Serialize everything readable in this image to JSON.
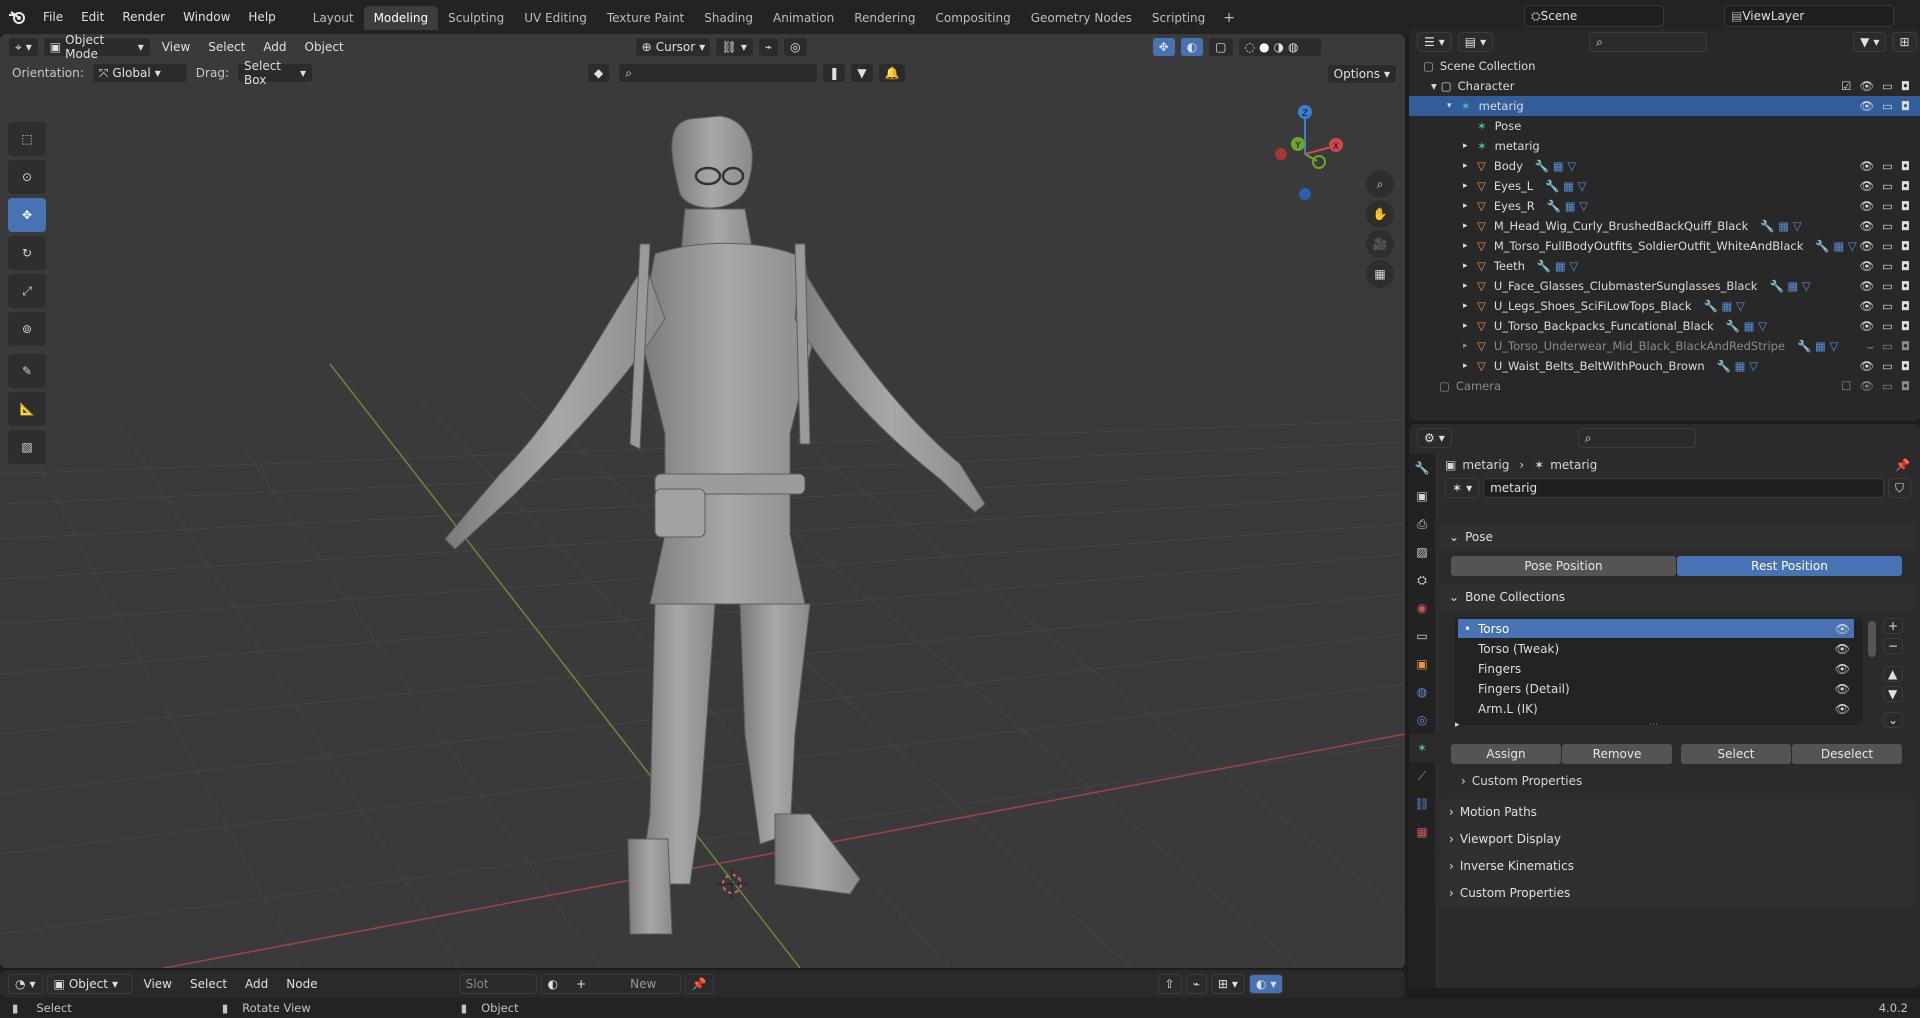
{
  "menu": [
    "File",
    "Edit",
    "Render",
    "Window",
    "Help"
  ],
  "workspaces": [
    "Layout",
    "Modeling",
    "Sculpting",
    "UV Editing",
    "Texture Paint",
    "Shading",
    "Animation",
    "Rendering",
    "Compositing",
    "Geometry Nodes",
    "Scripting"
  ],
  "active_workspace": "Modeling",
  "scene": "Scene",
  "view_layer": "ViewLayer",
  "viewport": {
    "mode": "Object Mode",
    "menus": [
      "View",
      "Select",
      "Add",
      "Object"
    ],
    "orientation_label": "Orientation:",
    "orientation": "Global",
    "drag_label": "Drag:",
    "drag": "Select Box",
    "pivot": "Cursor",
    "options": "Options"
  },
  "outliner": {
    "root": "Scene Collection",
    "collection": "Character",
    "items": [
      {
        "name": "metarig",
        "selected": true
      },
      {
        "name": "Pose"
      },
      {
        "name": "metarig"
      },
      {
        "name": "Body"
      },
      {
        "name": "Eyes_L"
      },
      {
        "name": "Eyes_R"
      },
      {
        "name": "M_Head_Wig_Curly_BrushedBackQuiff_Black"
      },
      {
        "name": "M_Torso_FullBodyOutfits_SoldierOutfit_WhiteAndBlack"
      },
      {
        "name": "Teeth"
      },
      {
        "name": "U_Face_Glasses_ClubmasterSunglasses_Black"
      },
      {
        "name": "U_Legs_Shoes_SciFiLowTops_Black"
      },
      {
        "name": "U_Torso_Backpacks_Funcational_Black"
      },
      {
        "name": "U_Torso_Underwear_Mid_Black_BlackAndRedStripe",
        "dim": true
      },
      {
        "name": "U_Waist_Belts_BeltWithPouch_Brown"
      }
    ],
    "camera": "Camera"
  },
  "properties": {
    "breadcrumb": [
      "metarig",
      "metarig"
    ],
    "data_name": "metarig",
    "pose_panel": "Pose",
    "pose_position": "Pose Position",
    "rest_position": "Rest Position",
    "bone_collections_panel": "Bone Collections",
    "bone_collections": [
      "Torso",
      "Torso (Tweak)",
      "Fingers",
      "Fingers (Detail)",
      "Arm.L (IK)"
    ],
    "assign": "Assign",
    "remove": "Remove",
    "select": "Select",
    "deselect": "Deselect",
    "custom_props_sub": "Custom Properties",
    "panels": [
      "Motion Paths",
      "Viewport Display",
      "Inverse Kinematics",
      "Custom Properties"
    ]
  },
  "bottom_editor": {
    "type": "Object",
    "menus": [
      "View",
      "Select",
      "Add",
      "Node"
    ],
    "slot": "Slot",
    "new": "New"
  },
  "status": {
    "select": "Select",
    "rotate": "Rotate View",
    "object": "Object",
    "version": "4.0.2"
  },
  "colors": {
    "accent": "#4772b3",
    "x_axis": "#d2464f",
    "y_axis": "#6ea62b",
    "z_axis": "#3a7fd6"
  }
}
